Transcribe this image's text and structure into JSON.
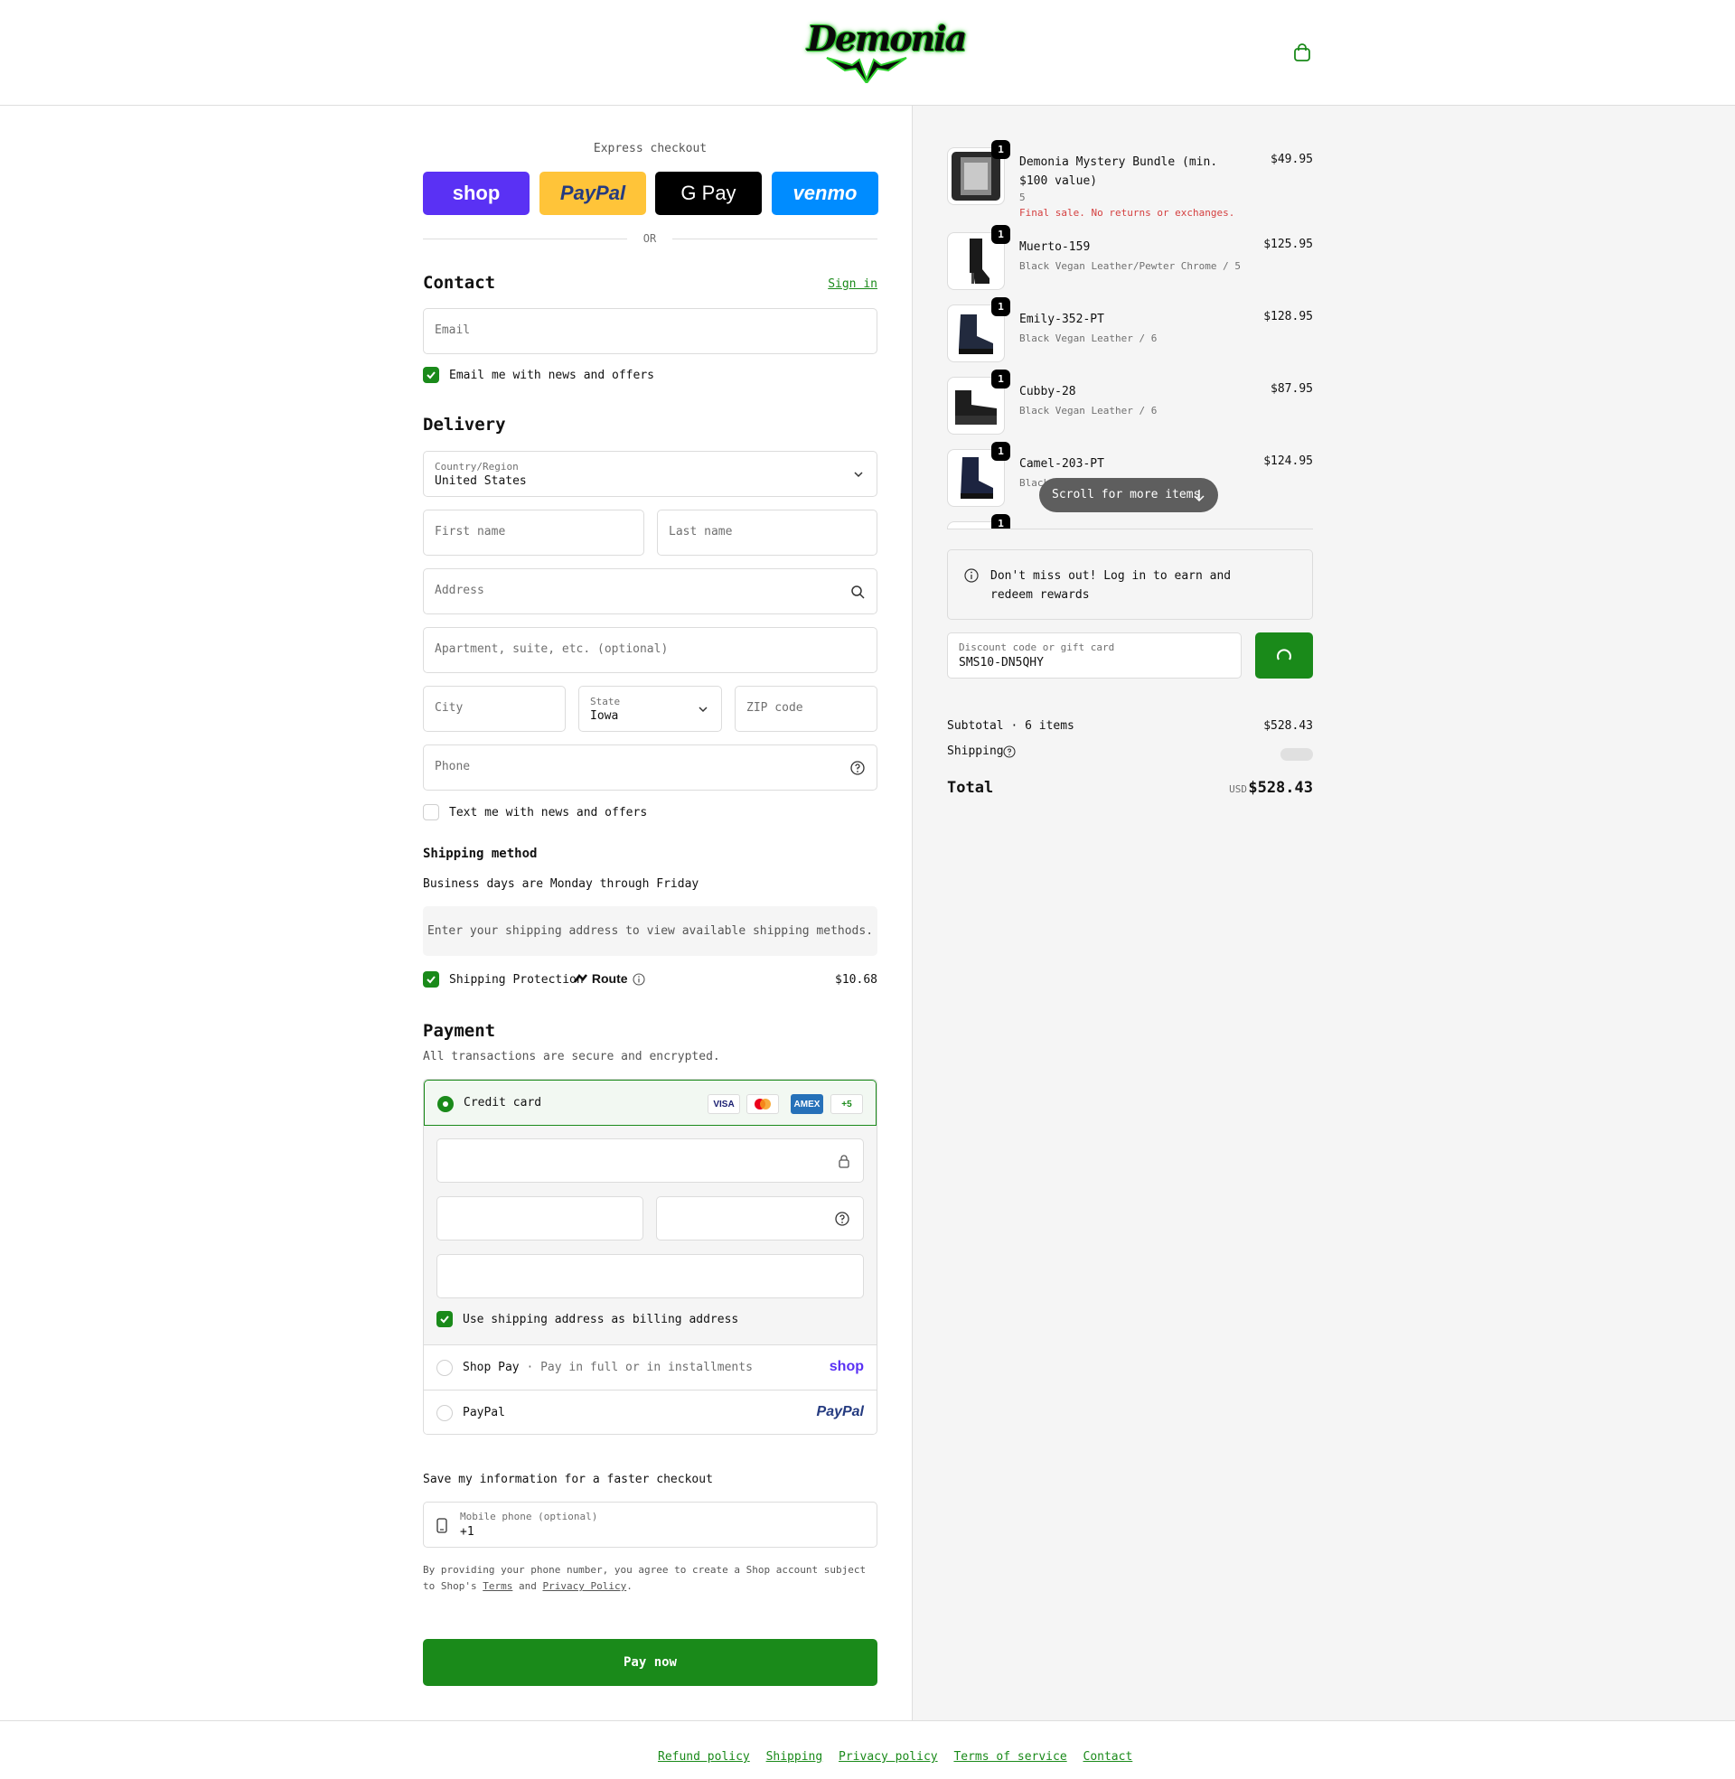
{
  "header": {
    "logo_alt": "Demonia",
    "logo_text": "Demonia",
    "cart_icon": "shopping-bag-icon"
  },
  "express": {
    "label": "Express checkout",
    "buttons": [
      "shop",
      "PayPal",
      "G Pay",
      "venmo"
    ],
    "or_label": "OR"
  },
  "contact": {
    "title": "Contact",
    "signin_label": "Sign in",
    "email_placeholder": "Email",
    "news_label": "Email me with news and offers",
    "news_checked": true
  },
  "delivery": {
    "title": "Delivery",
    "country_label": "Country/Region",
    "country_value": "United States",
    "first_name_placeholder": "First name",
    "last_name_placeholder": "Last name",
    "address_placeholder": "Address",
    "apartment_placeholder": "Apartment, suite, etc. (optional)",
    "city_placeholder": "City",
    "state_label": "State",
    "state_value": "Iowa",
    "zip_placeholder": "ZIP code",
    "phone_placeholder": "Phone",
    "text_label": "Text me with news and offers",
    "text_checked": false
  },
  "shipping": {
    "title": "Shipping method",
    "note": "Business days are Monday through Friday",
    "empty_message": "Enter your shipping address to view available shipping methods.",
    "protection_label": "Shipping Protection",
    "protection_brand": "Route",
    "protection_price": "$10.68",
    "protection_checked": true
  },
  "payment": {
    "title": "Payment",
    "subtitle": "All transactions are secure and encrypted.",
    "credit_card_label": "Credit card",
    "card_brands": [
      "VISA",
      "MC",
      "AMEX",
      "+5"
    ],
    "billing_label": "Use shipping address as billing address",
    "billing_checked": true,
    "shop_pay_label": "Shop Pay",
    "shop_pay_sub": "· Pay in full or in installments",
    "shop_pay_logo": "shop",
    "paypal_label": "PayPal",
    "paypal_logo": "PayPal"
  },
  "save_info": {
    "title": "Save my information for a faster checkout",
    "mobile_label": "Mobile phone (optional)",
    "mobile_value": "+1",
    "legal_prefix": "By providing your phone number, you agree to create a Shop account subject to Shop's ",
    "terms_link": "Terms",
    "legal_and": " and ",
    "privacy_link": "Privacy Policy",
    "legal_suffix": "."
  },
  "pay_now_label": "Pay now",
  "order": {
    "items": [
      {
        "name": "Demonia Mystery Bundle (min. $100 value)",
        "variant": "5",
        "price": "$49.95",
        "qty": "1",
        "note": "Final sale. No returns or exchanges."
      },
      {
        "name": "Muerto-159",
        "variant": "Black Vegan Leather/Pewter Chrome / 5",
        "price": "$125.95",
        "qty": "1"
      },
      {
        "name": "Emily-352-PT",
        "variant": "Black Vegan Leather / 6",
        "price": "$128.95",
        "qty": "1"
      },
      {
        "name": "Cubby-28",
        "variant": "Black Vegan Leather / 6",
        "price": "$87.95",
        "qty": "1"
      },
      {
        "name": "Camel-203-PT",
        "variant": "Black",
        "price": "$124.95",
        "qty": "1"
      },
      {
        "qty": "1"
      }
    ],
    "scroll_label": "Scroll for more items",
    "rewards_text": "Don't miss out! Log in to earn and redeem rewards",
    "discount_label": "Discount code or gift card",
    "discount_value": "SMS10-DN5QHY",
    "subtotal_label": "Subtotal · 6 items",
    "subtotal_value": "$528.43",
    "shipping_label": "Shipping",
    "total_label": "Total",
    "total_currency": "USD",
    "total_value": "$528.43"
  },
  "footer": {
    "links": [
      "Refund policy",
      "Shipping",
      "Privacy policy",
      "Terms of service",
      "Contact"
    ]
  },
  "colors": {
    "accent": "#1a8a1a",
    "shop": "#5a31f4",
    "paypal": "#ffc439",
    "venmo": "#008cff",
    "sale": "#d43f3f"
  }
}
